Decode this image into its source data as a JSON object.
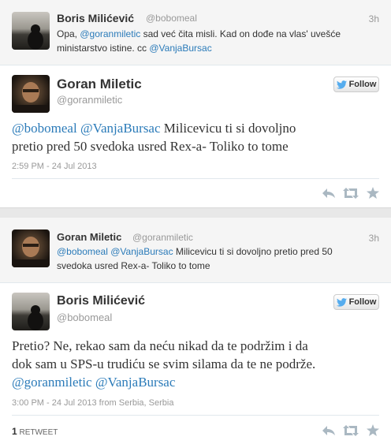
{
  "tweet1": {
    "name": "Boris Milićević",
    "handle": "@bobomeal",
    "time": "3h",
    "text_prefix": "Opa, ",
    "mention1": "@goranmiletic",
    "text_mid": " sad već čita misli. Kad on dođe na vlas' uvešće",
    "text_line2": "ministarstvo istine. cc ",
    "mention2": "@VanjaBursac"
  },
  "tweet2": {
    "name": "Goran Miletic",
    "handle": "@goranmiletic",
    "follow_label": "Follow",
    "mention1": "@bobomeal",
    "mention2": "@VanjaBursac",
    "text_line1_rest": " Milicevicu ti si dovoljno",
    "text_line2": "pretio pred 50 svedoka usred Rex-a- Toliko to tome",
    "timestamp": "2:59 PM - 24 Jul 2013"
  },
  "tweet3": {
    "name": "Goran Miletic",
    "handle": "@goranmiletic",
    "time": "3h",
    "mention1": "@bobomeal",
    "mention2": "@VanjaBursac",
    "text_line1_rest": " Milicevicu ti si dovoljno pretio pred 50",
    "text_line2": "svedoka usred Rex-a- Toliko to tome"
  },
  "tweet4": {
    "name": "Boris Milićević",
    "handle": "@bobomeal",
    "follow_label": "Follow",
    "text_line1": "Pretio? Ne, rekao sam da neću nikad da te podržim i da",
    "text_line2": "dok sam u SPS-u trudiću se svim silama da te ne podrže.",
    "mention1": "@goranmiletic",
    "mention2": "@VanjaBursac",
    "timestamp": "3:00 PM - 24 Jul 2013 from Serbia, Serbia",
    "retweet_count": "1",
    "retweet_label": "RETWEET"
  },
  "icons": [
    "reply-icon",
    "retweet-icon",
    "favorite-icon",
    "twitter-bird-icon"
  ],
  "colors": {
    "link": "#2b7bb9",
    "bird": "#55acee",
    "muted": "#999999"
  }
}
